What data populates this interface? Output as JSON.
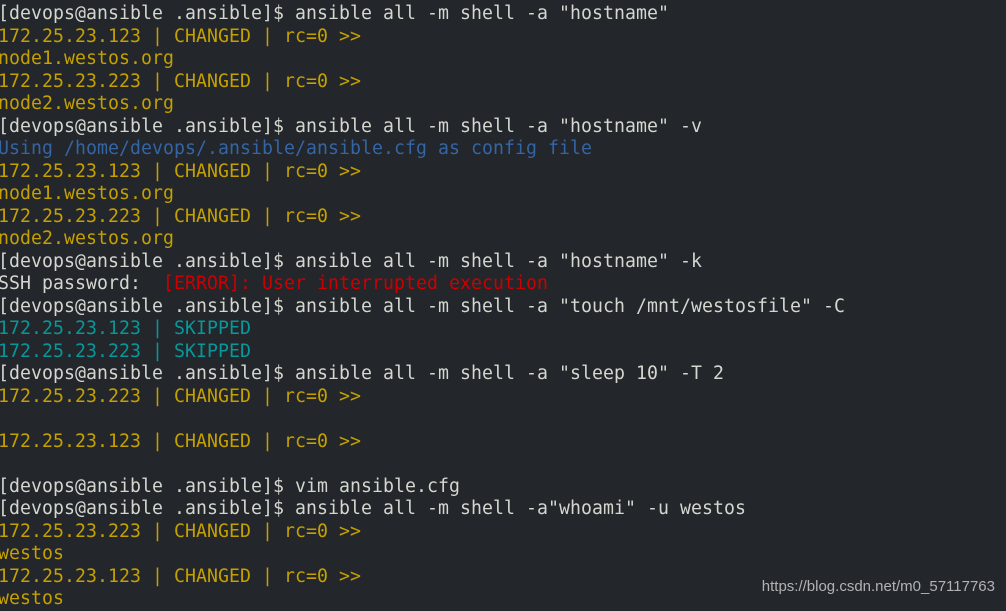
{
  "terminal": {
    "prompt": "[devops@ansible .ansible]$ ",
    "colors": {
      "background": "#23262a",
      "foreground": "#d3d7cf",
      "changed": "#c4a000",
      "info": "#3465a4",
      "skipped": "#06989a",
      "error": "#cc0000"
    },
    "lines": [
      {
        "type": "command",
        "text": "ansible all -m shell -a \"hostname\""
      },
      {
        "type": "changed",
        "text": "172.25.23.123 | CHANGED | rc=0 >>"
      },
      {
        "type": "changed",
        "text": "node1.westos.org"
      },
      {
        "type": "changed",
        "text": "172.25.23.223 | CHANGED | rc=0 >>"
      },
      {
        "type": "changed",
        "text": "node2.westos.org"
      },
      {
        "type": "command",
        "text": "ansible all -m shell -a \"hostname\" -v"
      },
      {
        "type": "info",
        "text": "Using /home/devops/.ansible/ansible.cfg as config file"
      },
      {
        "type": "changed",
        "text": "172.25.23.123 | CHANGED | rc=0 >>"
      },
      {
        "type": "changed",
        "text": "node1.westos.org"
      },
      {
        "type": "changed",
        "text": "172.25.23.223 | CHANGED | rc=0 >>"
      },
      {
        "type": "changed",
        "text": "node2.westos.org"
      },
      {
        "type": "command",
        "text": "ansible all -m shell -a \"hostname\" -k"
      },
      {
        "type": "password",
        "label": "SSH password:  ",
        "error": "[ERROR]: User interrupted execution"
      },
      {
        "type": "command",
        "text": "ansible all -m shell -a \"touch /mnt/westosfile\" -C"
      },
      {
        "type": "skipped",
        "text": "172.25.23.123 | SKIPPED"
      },
      {
        "type": "skipped",
        "text": "172.25.23.223 | SKIPPED"
      },
      {
        "type": "command",
        "text": "ansible all -m shell -a \"sleep 10\" -T 2"
      },
      {
        "type": "changed",
        "text": "172.25.23.223 | CHANGED | rc=0 >>"
      },
      {
        "type": "blank",
        "text": ""
      },
      {
        "type": "changed",
        "text": "172.25.23.123 | CHANGED | rc=0 >>"
      },
      {
        "type": "blank",
        "text": ""
      },
      {
        "type": "command",
        "text": "vim ansible.cfg"
      },
      {
        "type": "command",
        "text": "ansible all -m shell -a\"whoami\" -u westos"
      },
      {
        "type": "changed",
        "text": "172.25.23.223 | CHANGED | rc=0 >>"
      },
      {
        "type": "changed",
        "text": "westos"
      },
      {
        "type": "changed",
        "text": "172.25.23.123 | CHANGED | rc=0 >>"
      },
      {
        "type": "changed",
        "text": "westos"
      }
    ]
  },
  "watermark": "https://blog.csdn.net/m0_57117763"
}
